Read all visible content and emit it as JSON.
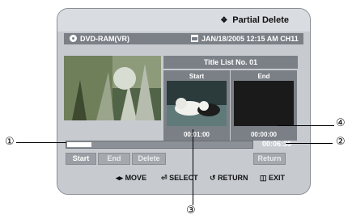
{
  "header": {
    "title": "Partial Delete",
    "title_icon": "diamond-icon"
  },
  "info_bar": {
    "disc": "DVD-RAM(VR)",
    "datetime": "JAN/18/2005 12:15 AM CH11"
  },
  "title_list": "Title List No. 01",
  "start_panel": {
    "label": "Start",
    "time": "00:01:00"
  },
  "end_panel": {
    "label": "End",
    "time": "00:00:00"
  },
  "progress": {
    "fraction": 0.13,
    "total_time": "00:06:35"
  },
  "buttons": {
    "start": "Start",
    "end": "End",
    "delete": "Delete",
    "return": "Return"
  },
  "nav": {
    "move": "MOVE",
    "select": "SELECT",
    "return": "RETURN",
    "exit": "EXIT"
  },
  "annotations": {
    "one": "①",
    "two": "②",
    "three": "③",
    "four": "④"
  }
}
